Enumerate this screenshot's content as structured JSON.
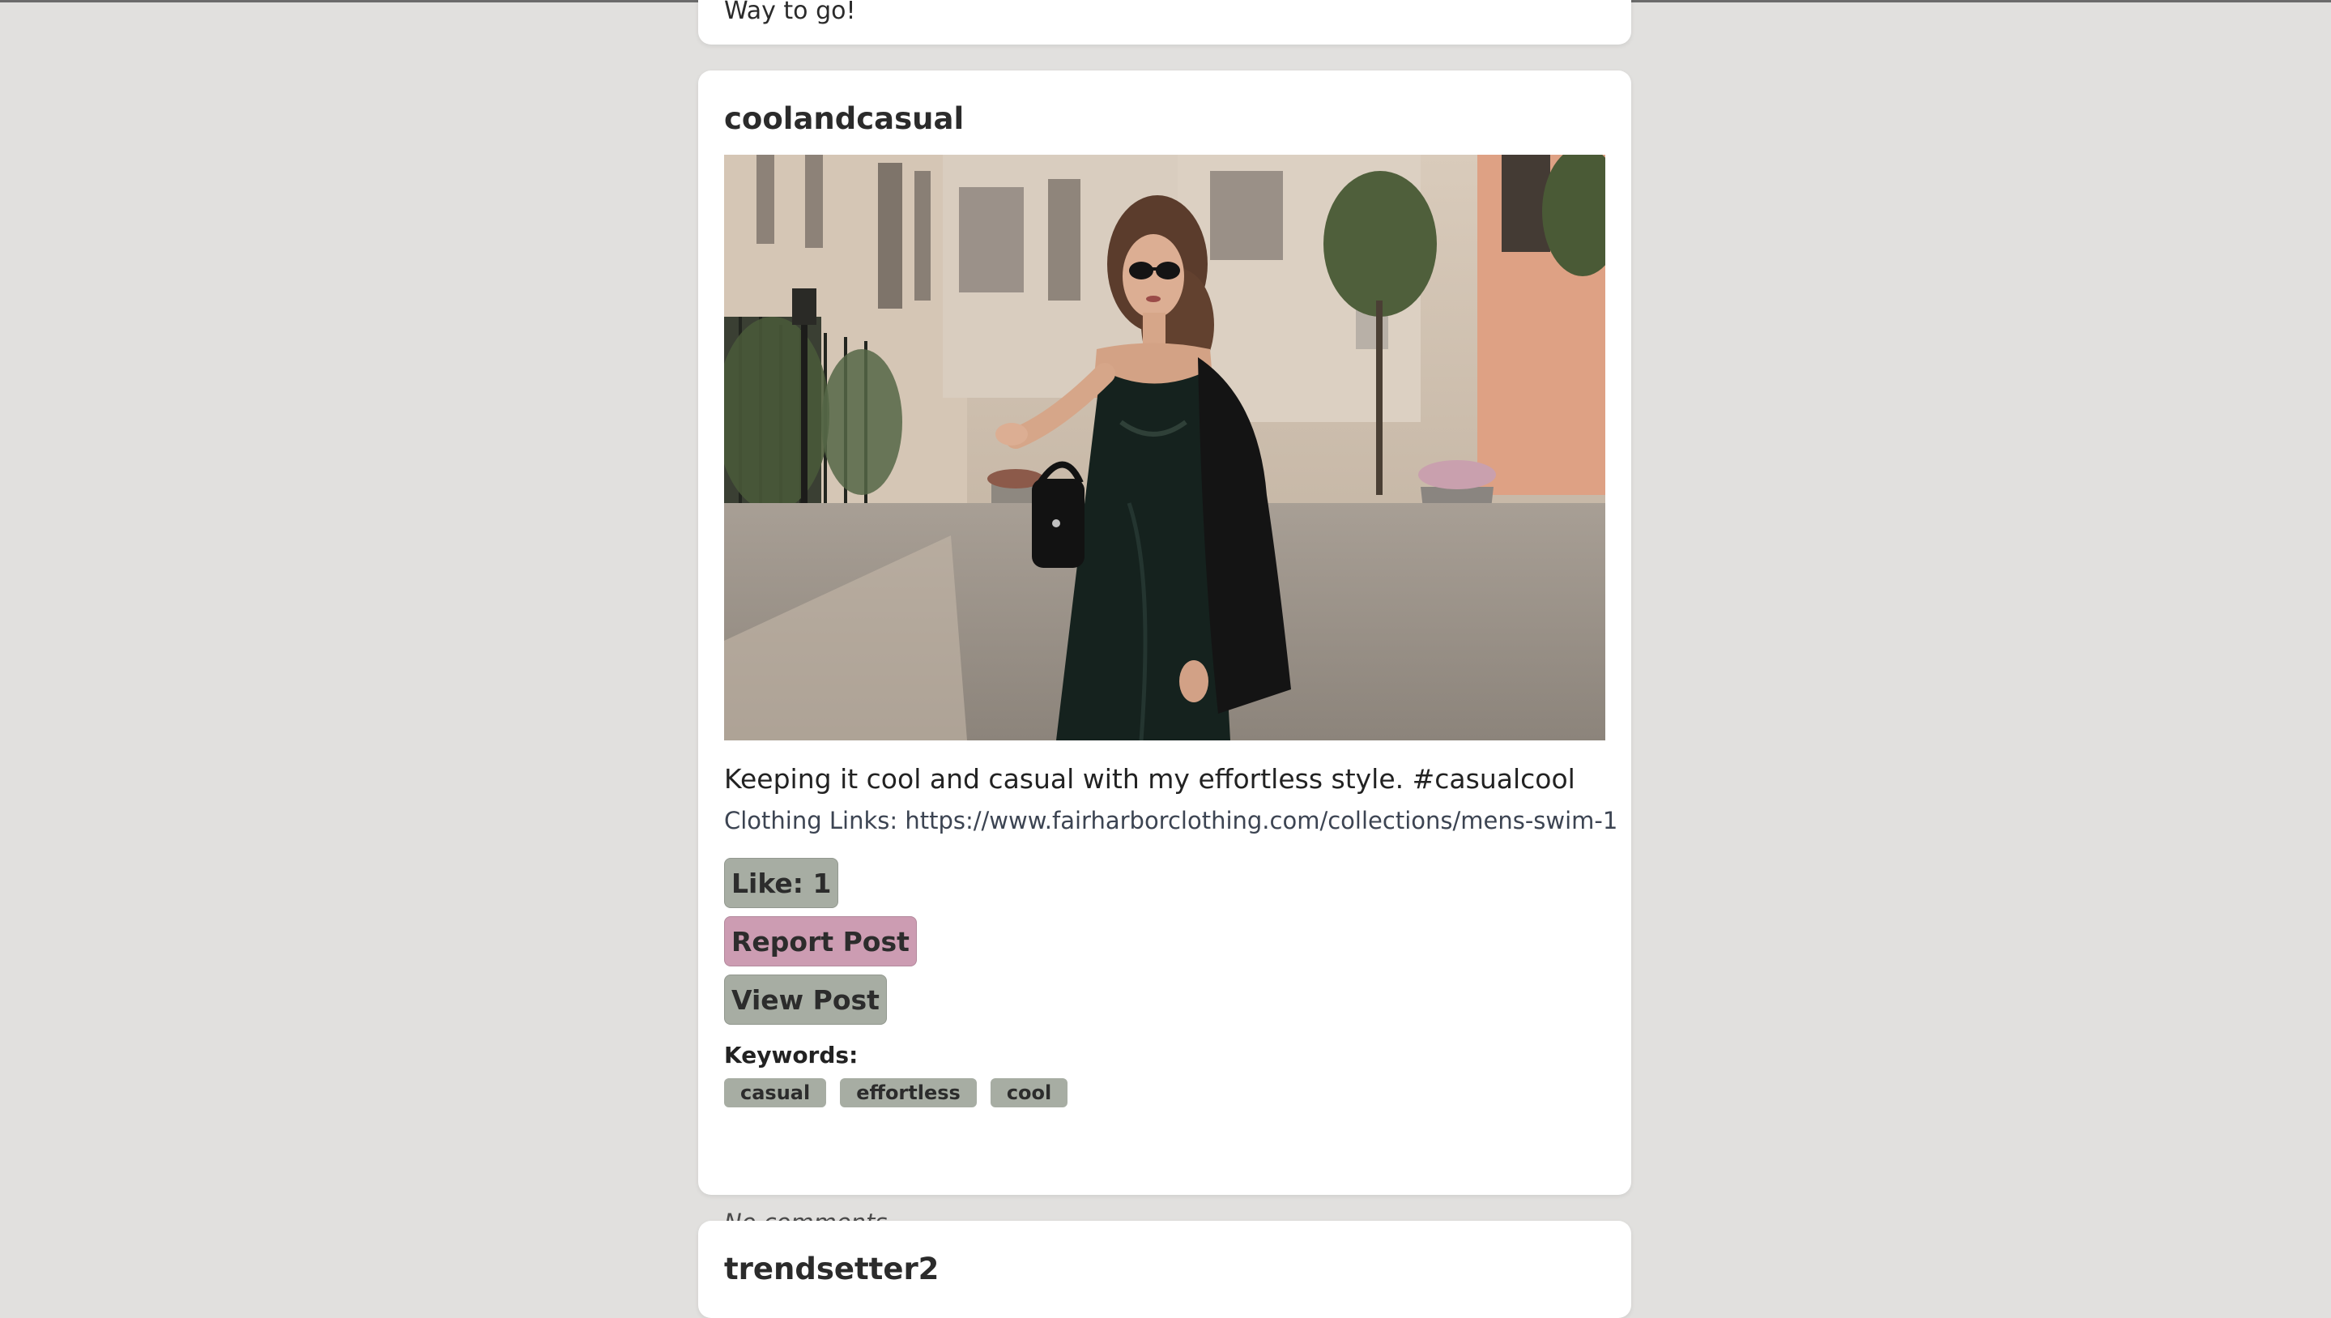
{
  "previous_post": {
    "comment_text": "Way to go!"
  },
  "post": {
    "username": "coolandcasual",
    "caption": "Keeping it cool and casual with my effortless style. #casualcool",
    "clothing_links_label": "Clothing Links: https://www.fairharborclothing.com/collections/mens-swim-1",
    "like_label": "Like: 1",
    "report_label": "Report Post",
    "view_label": "View Post",
    "keywords_label": "Keywords:",
    "keywords": [
      "casual",
      "effortless",
      "cool"
    ],
    "comments_status": "No comments",
    "image_description_icon": "photo-woman-in-dark-slip-dress-street"
  },
  "next_post": {
    "username": "trendsetter2"
  },
  "colors": {
    "page_background": "#e1e0de",
    "card_background": "#ffffff",
    "button_neutral": "#a7ada3",
    "button_report": "#cc9cb2",
    "text_primary": "#2b2b2b",
    "text_link": "#3c4452"
  }
}
